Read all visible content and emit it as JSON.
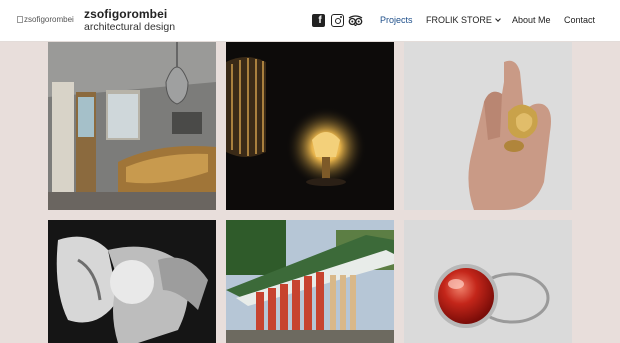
{
  "header": {
    "logo_alt": "zsofigorombei",
    "site_title": "zsofigorombei",
    "tagline": "architectural design"
  },
  "social": [
    {
      "icon": "facebook-icon"
    },
    {
      "icon": "instagram-icon"
    },
    {
      "icon": "tripadvisor-icon"
    }
  ],
  "nav": {
    "projects": "Projects",
    "store": "FROLIK STORE",
    "about": "About Me",
    "contact": "Contact"
  },
  "colors": {
    "page_background": "#e8dedb",
    "header_background": "#ffffff",
    "active_nav": "#1e4f8a"
  }
}
